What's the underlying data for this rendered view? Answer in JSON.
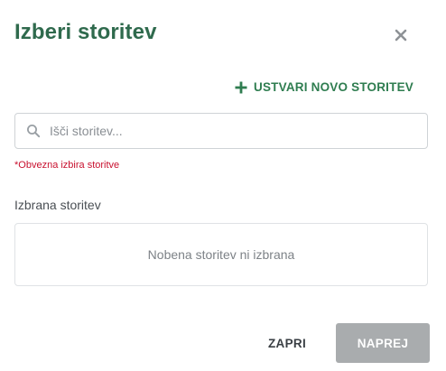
{
  "dialog": {
    "title": "Izberi storitev",
    "create_label": "USTVARI NOVO STORITEV",
    "search": {
      "placeholder": "Išči storitev...",
      "value": ""
    },
    "required_message": "*Obvezna izbira storitve",
    "selected_label": "Izbrana storitev",
    "selected_empty": "Nobena storitev ni izbrana",
    "buttons": {
      "close": "ZAPRI",
      "next": "NAPREJ"
    }
  },
  "icons": {
    "close": "close-icon",
    "plus": "plus-icon",
    "search": "search-icon"
  },
  "colors": {
    "title": "#2f6a4d",
    "accent": "#2f7d50",
    "error": "#c8102e",
    "disabled_button": "#a9acae"
  }
}
